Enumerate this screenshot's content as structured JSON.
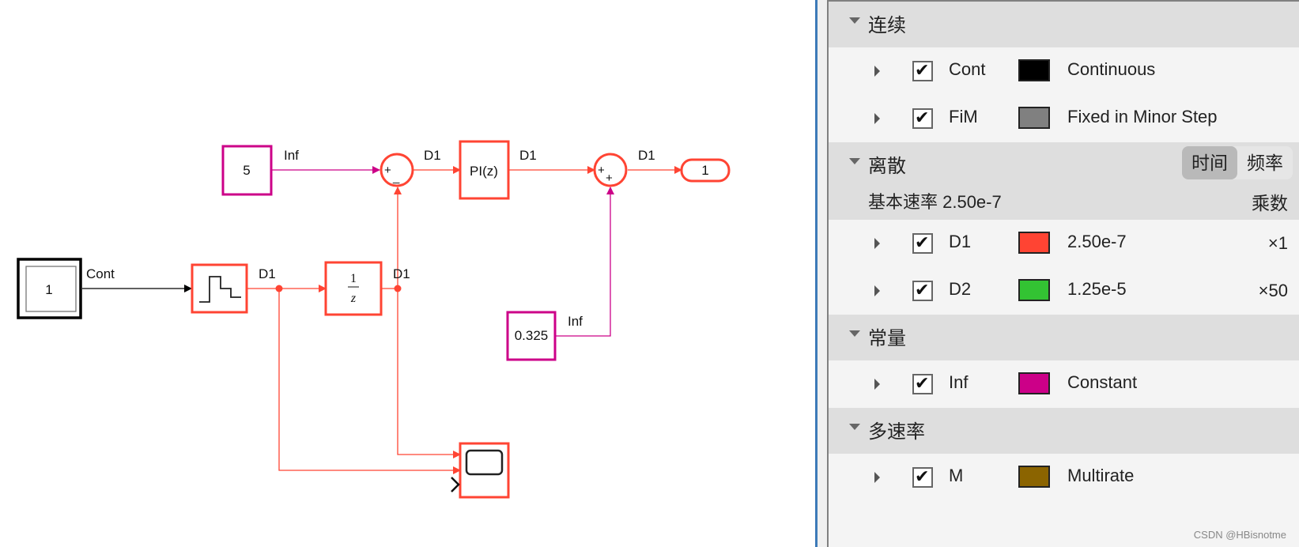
{
  "colors": {
    "continuous": "#000000",
    "fixed_minor": "#808080",
    "d1": "#ff4433",
    "d2": "#33c333",
    "constant": "#cc0088",
    "multirate": "#8b6400"
  },
  "diagram": {
    "blocks": {
      "constant_5": "5",
      "constant_0325": "0.325",
      "constant_1_input": "1",
      "sum1_signs": "+−",
      "pi_controller": "PI(z)",
      "unit_delay_num": "1",
      "unit_delay_den": "z",
      "sum2_signs": "++",
      "outport": "1"
    },
    "signal_labels": {
      "constant5_out": "Inf",
      "input_out": "Cont",
      "zoh_out": "D1",
      "delay_out": "D1",
      "sum1_out": "D1",
      "pi_out": "D1",
      "sum2_out": "D1",
      "constant0325_out": "Inf"
    }
  },
  "legend": {
    "sections": [
      {
        "title": "连续",
        "rows": [
          {
            "abbr": "Cont",
            "color": "#000000",
            "desc": "Continuous",
            "checked": true
          },
          {
            "abbr": "FiM",
            "color": "#808080",
            "desc": "Fixed in Minor Step",
            "checked": true
          }
        ]
      },
      {
        "title": "离散",
        "toggle": {
          "options": [
            "时间",
            "频率"
          ],
          "selected": "时间"
        },
        "base_rate_label": "基本速率 2.50e-7",
        "multiplier_header": "乘数",
        "rows": [
          {
            "abbr": "D1",
            "color": "#ff4433",
            "desc": "2.50e-7",
            "mult": "×1",
            "checked": true
          },
          {
            "abbr": "D2",
            "color": "#33c333",
            "desc": "1.25e-5",
            "mult": "×50",
            "checked": true
          }
        ]
      },
      {
        "title": "常量",
        "rows": [
          {
            "abbr": "Inf",
            "color": "#cc0088",
            "desc": "Constant",
            "checked": true
          }
        ]
      },
      {
        "title": "多速率",
        "rows": [
          {
            "abbr": "M",
            "color": "#8b6400",
            "desc": "Multirate",
            "checked": true
          }
        ]
      }
    ],
    "checkmark": "✔"
  },
  "watermark": "CSDN @HBisnotme"
}
